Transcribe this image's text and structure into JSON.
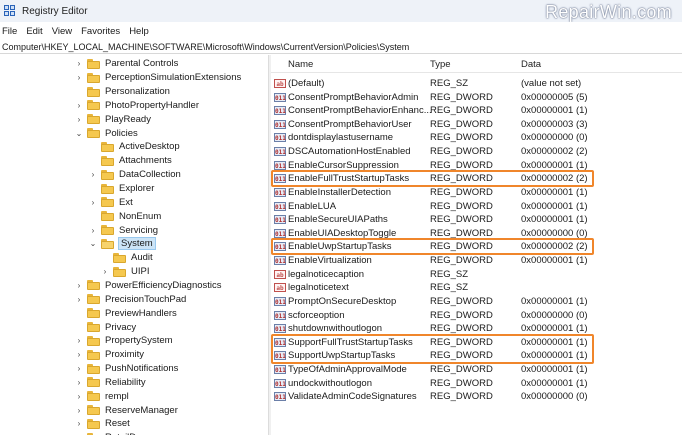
{
  "window": {
    "title": "Registry Editor",
    "watermark": "RepairWin.com"
  },
  "menu": [
    "File",
    "Edit",
    "View",
    "Favorites",
    "Help"
  ],
  "address": "Computer\\HKEY_LOCAL_MACHINE\\SOFTWARE\\Microsoft\\Windows\\CurrentVersion\\Policies\\System",
  "tree": [
    {
      "label": "Parental Controls",
      "level": 0,
      "chev": "›"
    },
    {
      "label": "PerceptionSimulationExtensions",
      "level": 0,
      "chev": "›"
    },
    {
      "label": "Personalization",
      "level": 0,
      "chev": ""
    },
    {
      "label": "PhotoPropertyHandler",
      "level": 0,
      "chev": "›"
    },
    {
      "label": "PlayReady",
      "level": 0,
      "chev": "›"
    },
    {
      "label": "Policies",
      "level": 0,
      "chev": "⌄"
    },
    {
      "label": "ActiveDesktop",
      "level": 1,
      "chev": ""
    },
    {
      "label": "Attachments",
      "level": 1,
      "chev": ""
    },
    {
      "label": "DataCollection",
      "level": 1,
      "chev": "›"
    },
    {
      "label": "Explorer",
      "level": 1,
      "chev": ""
    },
    {
      "label": "Ext",
      "level": 1,
      "chev": "›"
    },
    {
      "label": "NonEnum",
      "level": 1,
      "chev": ""
    },
    {
      "label": "Servicing",
      "level": 1,
      "chev": "›"
    },
    {
      "label": "System",
      "level": 1,
      "chev": "⌄",
      "selected": true
    },
    {
      "label": "Audit",
      "level": 2,
      "chev": ""
    },
    {
      "label": "UIPI",
      "level": 2,
      "chev": "›"
    },
    {
      "label": "PowerEfficiencyDiagnostics",
      "level": 0,
      "chev": "›"
    },
    {
      "label": "PrecisionTouchPad",
      "level": 0,
      "chev": "›"
    },
    {
      "label": "PreviewHandlers",
      "level": 0,
      "chev": ""
    },
    {
      "label": "Privacy",
      "level": 0,
      "chev": ""
    },
    {
      "label": "PropertySystem",
      "level": 0,
      "chev": "›"
    },
    {
      "label": "Proximity",
      "level": 0,
      "chev": "›"
    },
    {
      "label": "PushNotifications",
      "level": 0,
      "chev": "›"
    },
    {
      "label": "Reliability",
      "level": 0,
      "chev": "›"
    },
    {
      "label": "rempl",
      "level": 0,
      "chev": "›"
    },
    {
      "label": "ReserveManager",
      "level": 0,
      "chev": "›"
    },
    {
      "label": "Reset",
      "level": 0,
      "chev": "›"
    },
    {
      "label": "RetailDemo",
      "level": 0,
      "chev": "›"
    }
  ],
  "columns": {
    "name": "Name",
    "type": "Type",
    "data": "Data"
  },
  "values": [
    {
      "name": "(Default)",
      "type": "REG_SZ",
      "data": "(value not set)",
      "icon": "ab"
    },
    {
      "name": "ConsentPromptBehaviorAdmin",
      "type": "REG_DWORD",
      "data": "0x00000005 (5)",
      "icon": "dw"
    },
    {
      "name": "ConsentPromptBehaviorEnhanc...",
      "type": "REG_DWORD",
      "data": "0x00000001 (1)",
      "icon": "dw"
    },
    {
      "name": "ConsentPromptBehaviorUser",
      "type": "REG_DWORD",
      "data": "0x00000003 (3)",
      "icon": "dw"
    },
    {
      "name": "dontdisplaylastusername",
      "type": "REG_DWORD",
      "data": "0x00000000 (0)",
      "icon": "dw"
    },
    {
      "name": "DSCAutomationHostEnabled",
      "type": "REG_DWORD",
      "data": "0x00000002 (2)",
      "icon": "dw"
    },
    {
      "name": "EnableCursorSuppression",
      "type": "REG_DWORD",
      "data": "0x00000001 (1)",
      "icon": "dw"
    },
    {
      "name": "EnableFullTrustStartupTasks",
      "type": "REG_DWORD",
      "data": "0x00000002 (2)",
      "icon": "dw",
      "highlight": true
    },
    {
      "name": "EnableInstallerDetection",
      "type": "REG_DWORD",
      "data": "0x00000001 (1)",
      "icon": "dw"
    },
    {
      "name": "EnableLUA",
      "type": "REG_DWORD",
      "data": "0x00000001 (1)",
      "icon": "dw"
    },
    {
      "name": "EnableSecureUIAPaths",
      "type": "REG_DWORD",
      "data": "0x00000001 (1)",
      "icon": "dw"
    },
    {
      "name": "EnableUIADesktopToggle",
      "type": "REG_DWORD",
      "data": "0x00000000 (0)",
      "icon": "dw"
    },
    {
      "name": "EnableUwpStartupTasks",
      "type": "REG_DWORD",
      "data": "0x00000002 (2)",
      "icon": "dw",
      "highlight": true
    },
    {
      "name": "EnableVirtualization",
      "type": "REG_DWORD",
      "data": "0x00000001 (1)",
      "icon": "dw"
    },
    {
      "name": "legalnoticecaption",
      "type": "REG_SZ",
      "data": "",
      "icon": "ab"
    },
    {
      "name": "legalnoticetext",
      "type": "REG_SZ",
      "data": "",
      "icon": "ab"
    },
    {
      "name": "PromptOnSecureDesktop",
      "type": "REG_DWORD",
      "data": "0x00000001 (1)",
      "icon": "dw"
    },
    {
      "name": "scforceoption",
      "type": "REG_DWORD",
      "data": "0x00000000 (0)",
      "icon": "dw"
    },
    {
      "name": "shutdownwithoutlogon",
      "type": "REG_DWORD",
      "data": "0x00000001 (1)",
      "icon": "dw"
    },
    {
      "name": "SupportFullTrustStartupTasks",
      "type": "REG_DWORD",
      "data": "0x00000001 (1)",
      "icon": "dw",
      "highlight": true
    },
    {
      "name": "SupportUwpStartupTasks",
      "type": "REG_DWORD",
      "data": "0x00000001 (1)",
      "icon": "dw",
      "highlight": true
    },
    {
      "name": "TypeOfAdminApprovalMode",
      "type": "REG_DWORD",
      "data": "0x00000001 (1)",
      "icon": "dw"
    },
    {
      "name": "undockwithoutlogon",
      "type": "REG_DWORD",
      "data": "0x00000001 (1)",
      "icon": "dw"
    },
    {
      "name": "ValidateAdminCodeSignatures",
      "type": "REG_DWORD",
      "data": "0x00000000 (0)",
      "icon": "dw"
    }
  ],
  "icon_labels": {
    "ab": "ab",
    "dw": "011"
  },
  "colors": {
    "highlight_box": "#f0862b",
    "selected_node": "#cce4f7"
  }
}
